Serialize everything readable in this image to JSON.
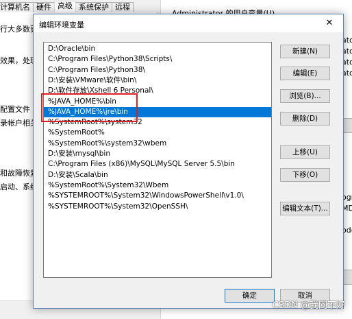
{
  "sysprops": {
    "tabs": [
      "计算机名",
      "硬件",
      "高级",
      "系统保护",
      "远程"
    ],
    "active_tab": 2,
    "fragments": [
      {
        "text": "行大多数更改"
      },
      {
        "text": "效果，处理"
      },
      {
        "text": "配置文件"
      },
      {
        "text": "录帐户相关"
      },
      {
        "text": "和故障恢复"
      },
      {
        "text": "启动、系统"
      }
    ]
  },
  "envvars": {
    "title": "Administrator 的用户变量(U)",
    "fragments": [
      {
        "text": "ator'"
      },
      {
        "text": "ator'"
      },
      {
        "text": "ator'"
      },
      {
        "text": "ator'"
      },
      {
        "text": "ogra"
      },
      {
        "text": "MD;."
      },
      {
        "text": "odel"
      }
    ]
  },
  "dialog": {
    "title": "编辑环境变量",
    "close_label": "✕",
    "entries": [
      "D:\\Oracle\\bin",
      "C:\\Program Files\\Python38\\Scripts\\",
      "C:\\Program Files\\Python38\\",
      "D:\\安装\\VMware\\软件\\bin\\",
      "D:\\软件存放\\Xshell 6 Personal\\",
      "%JAVA_HOME%\\bin",
      "%JAVA_HOME%\\jre\\bin",
      "%SystemRoot%\\system32",
      "%SystemRoot%",
      "%SystemRoot%\\system32\\wbem",
      "D:\\安装\\mysql\\bin",
      "C:\\Program Files (x86)\\MySQL\\MySQL Server 5.5\\bin",
      "D:\\安装\\Scala\\bin",
      "%SystemRoot%\\System32\\Wbem",
      "%SYSTEMROOT%\\System32\\WindowsPowerShell\\v1.0\\",
      "%SYSTEMROOT%\\System32\\OpenSSH\\"
    ],
    "selected_index": 6,
    "buttons": {
      "new": "新建(N)",
      "edit": "编辑(E)",
      "browse": "浏览(B)...",
      "delete": "删除(D)",
      "move_up": "上移(U)",
      "move_down": "下移(O)",
      "edit_text": "编辑文本(T)...",
      "ok": "确定",
      "cancel": "取消"
    }
  },
  "watermark": "CSDN @我网不好",
  "colors": {
    "selection": "#0078d7",
    "highlight_box": "#e02020"
  }
}
